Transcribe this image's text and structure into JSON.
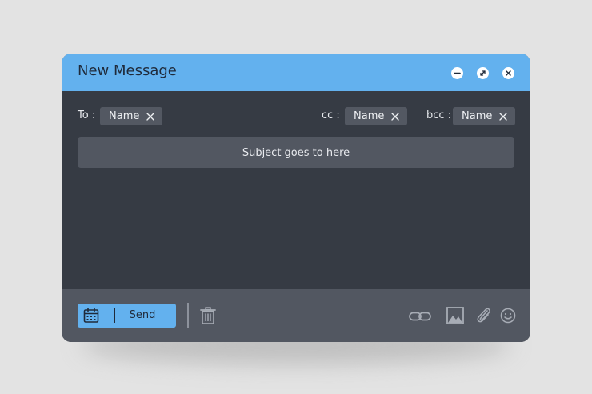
{
  "window": {
    "title": "New Message",
    "controls": [
      "minimize-icon",
      "expand-icon",
      "close-icon"
    ]
  },
  "recipients": {
    "to": {
      "label": "To :",
      "chips": [
        "Name"
      ]
    },
    "cc": {
      "label": "cc :",
      "chips": [
        "Name"
      ]
    },
    "bcc": {
      "label": "bcc :",
      "chips": [
        "Name"
      ]
    }
  },
  "subject": {
    "placeholder": "Subject goes to here"
  },
  "footer": {
    "send_label": "Send",
    "icons": [
      "calendar-icon",
      "trash-icon",
      "link-icon",
      "image-icon",
      "paperclip-icon",
      "smiley-icon"
    ]
  },
  "colors": {
    "accent": "#63b1ee",
    "window_body": "#363b44",
    "panel": "#525761",
    "background": "#e3e3e3",
    "dark_text": "#1f2a3a"
  }
}
